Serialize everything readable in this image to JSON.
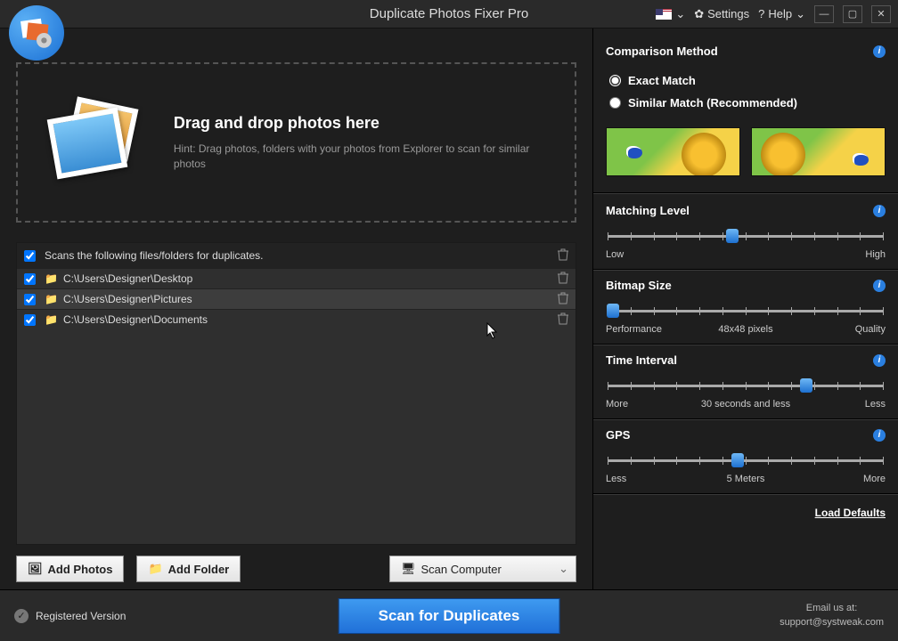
{
  "app_title": "Duplicate Photos Fixer Pro",
  "titlebar": {
    "settings": "Settings",
    "help": "Help"
  },
  "dropzone": {
    "heading": "Drag and drop photos here",
    "hint": "Hint: Drag photos, folders with your photos from Explorer to scan for similar photos"
  },
  "filelist": {
    "header_text": "Scans the following files/folders for duplicates.",
    "rows": [
      {
        "path": "C:\\Users\\Designer\\Desktop",
        "checked": true,
        "active": false
      },
      {
        "path": "C:\\Users\\Designer\\Pictures",
        "checked": true,
        "active": true
      },
      {
        "path": "C:\\Users\\Designer\\Documents",
        "checked": true,
        "active": false
      }
    ]
  },
  "buttons": {
    "add_photos": "Add Photos",
    "add_folder": "Add Folder",
    "scan_computer": "Scan Computer"
  },
  "comparison": {
    "title": "Comparison Method",
    "exact": "Exact Match",
    "similar": "Similar Match (Recommended)",
    "selected": "exact"
  },
  "sliders": {
    "matching": {
      "title": "Matching Level",
      "low": "Low",
      "high": "High",
      "pos": 45
    },
    "bitmap": {
      "title": "Bitmap Size",
      "low": "Performance",
      "high": "Quality",
      "center": "48x48 pixels",
      "pos": 2
    },
    "time": {
      "title": "Time Interval",
      "low": "More",
      "high": "Less",
      "center": "30 seconds and less",
      "pos": 72
    },
    "gps": {
      "title": "GPS",
      "low": "Less",
      "high": "More",
      "center": "5 Meters",
      "pos": 47
    }
  },
  "load_defaults": "Load Defaults",
  "footer": {
    "registered": "Registered Version",
    "scan": "Scan for Duplicates",
    "email_label": "Email us at:",
    "email": "support@systweak.com"
  }
}
